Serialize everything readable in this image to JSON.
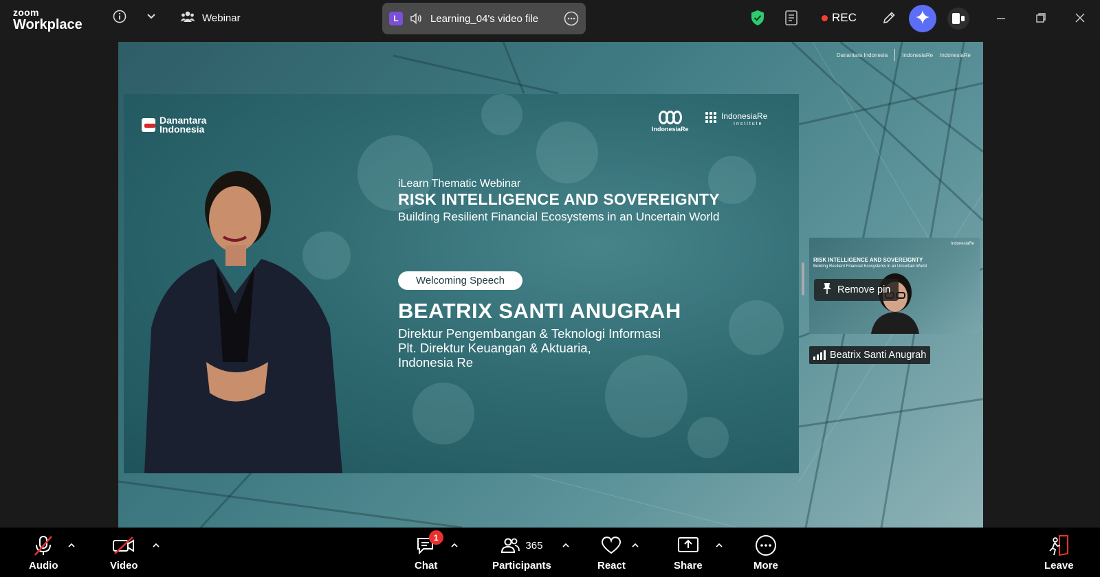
{
  "app": {
    "brand_line1": "zoom",
    "brand_line2": "Workplace"
  },
  "meeting": {
    "type_label": "Webinar"
  },
  "shared_file": {
    "avatar_letter": "L",
    "title": "Learning_04's video file"
  },
  "recording": {
    "label": "REC"
  },
  "slide": {
    "org_left": "Danantara Indonesia",
    "org_left_line1": "Danantara",
    "org_left_line2": "Indonesia",
    "org_right1": "IndonesiaRe",
    "org_right2": "IndonesiaRe",
    "org_right2_sub": "Institute",
    "kicker": "iLearn Thematic Webinar",
    "title": "RISK INTELLIGENCE AND SOVEREIGNTY",
    "subtitle": "Building Resilient Financial Ecosystems in an Uncertain World",
    "session": "Welcoming Speech",
    "speaker_name": "BEATRIX SANTI ANUGRAH",
    "speaker_role_lines": [
      "Direktur Pengembangan & Teknologi Informasi",
      "Plt. Direktur Keuangan & Aktuaria,",
      "Indonesia Re"
    ]
  },
  "thumbnail": {
    "remove_pin_label": "Remove pin",
    "participant_name": "Beatrix Santi Anugrah",
    "mini_title": "RISK INTELLIGENCE AND SOVEREIGNTY",
    "mini_subtitle": "Building Resilient Financial Ecosystems in an Uncertain World"
  },
  "toolbar": {
    "audio": "Audio",
    "video": "Video",
    "chat": "Chat",
    "chat_badge": "1",
    "participants": "Participants",
    "participants_count": "365",
    "react": "React",
    "share": "Share",
    "more": "More",
    "leave": "Leave"
  },
  "colors": {
    "accent_purple": "#5b6ef5",
    "shield_green": "#2ecc71",
    "rec_red": "#ff3b30",
    "leave_red": "#e8312f",
    "slide_teal": "#2f6a71"
  }
}
